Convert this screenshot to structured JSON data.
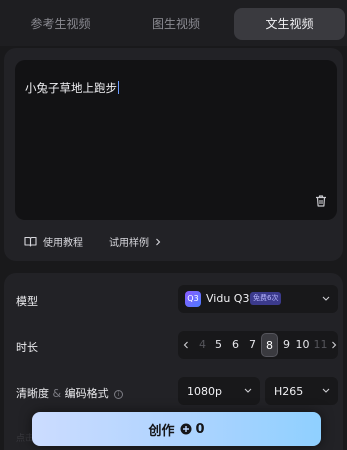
{
  "tabs": [
    {
      "label": "参考生视频",
      "active": false
    },
    {
      "label": "图生视频",
      "active": false
    },
    {
      "label": "文生视频",
      "active": true
    }
  ],
  "prompt": {
    "text": "小兔子草地上跑步"
  },
  "links": {
    "tutorial": "使用教程",
    "samples": "试用样例"
  },
  "settings": {
    "model_label": "模型",
    "model_name": "Vidu Q3",
    "model_badge": "免费6次",
    "duration_label": "时长",
    "duration_options": [
      "4",
      "5",
      "6",
      "7",
      "8",
      "9",
      "10",
      "11"
    ],
    "duration_selected": "8",
    "quality_label": "清晰度",
    "quality_sep": "&",
    "codec_label": "编码格式",
    "info_glyph": "i",
    "resolution": "1080p",
    "codec": "H265",
    "ghost_text": "点击"
  },
  "create": {
    "label": "创作",
    "credits": "0"
  },
  "icons": [
    "book-icon",
    "chevron-right-icon",
    "trash-icon",
    "chevron-down-icon",
    "chevron-left-icon",
    "credit-plus-icon"
  ],
  "colors": {
    "accent_gradient_start": "#ccdcff",
    "accent_gradient_end": "#8fd0ff",
    "badge_bg": "#3b3a8c",
    "caret": "#6b9cff"
  }
}
